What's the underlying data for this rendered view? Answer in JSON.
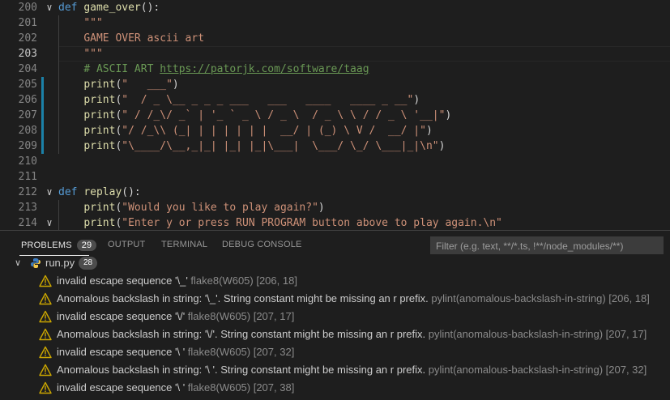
{
  "editor": {
    "lines": [
      {
        "num": "200",
        "fold": "∨",
        "tokens": [
          {
            "t": "def",
            "c": "kw"
          },
          {
            "t": " "
          },
          {
            "t": "game_over",
            "c": "fn"
          },
          {
            "t": "():"
          }
        ]
      },
      {
        "num": "201",
        "tokens": [
          {
            "t": "    "
          },
          {
            "t": "\"\"\"",
            "c": "str"
          }
        ]
      },
      {
        "num": "202",
        "tokens": [
          {
            "t": "    "
          },
          {
            "t": "GAME OVER ascii art",
            "c": "str"
          }
        ]
      },
      {
        "num": "203",
        "active": true,
        "current": true,
        "tokens": [
          {
            "t": "    "
          },
          {
            "t": "\"\"\"",
            "c": "str"
          }
        ]
      },
      {
        "num": "204",
        "tokens": [
          {
            "t": "    "
          },
          {
            "t": "# ASCII ART ",
            "c": "cmt"
          },
          {
            "t": "https://patorjk.com/software/taag",
            "c": "url"
          }
        ]
      },
      {
        "num": "205",
        "mod": true,
        "tokens": [
          {
            "t": "    "
          },
          {
            "t": "print",
            "c": "fn"
          },
          {
            "t": "("
          },
          {
            "t": "\"   ___\"",
            "c": "str"
          },
          {
            "t": ")"
          }
        ]
      },
      {
        "num": "206",
        "mod": true,
        "tokens": [
          {
            "t": "    "
          },
          {
            "t": "print",
            "c": "fn"
          },
          {
            "t": "("
          },
          {
            "t": "\"  / _ \\__ _ _ _ ___   ___   ____   ____ _ __\"",
            "c": "str"
          },
          {
            "t": ")"
          }
        ]
      },
      {
        "num": "207",
        "mod": true,
        "tokens": [
          {
            "t": "    "
          },
          {
            "t": "print",
            "c": "fn"
          },
          {
            "t": "("
          },
          {
            "t": "\" / /_\\/ _` | '_ ` _ \\ / _ \\  / _ \\ \\ / / _ \\ '__|\"",
            "c": "str"
          },
          {
            "t": ")"
          }
        ]
      },
      {
        "num": "208",
        "mod": true,
        "tokens": [
          {
            "t": "    "
          },
          {
            "t": "print",
            "c": "fn"
          },
          {
            "t": "("
          },
          {
            "t": "\"/ /_\\\\ (_| | | | | | |  __/ | (_) \\ V /  __/ |\"",
            "c": "str"
          },
          {
            "t": ")"
          }
        ]
      },
      {
        "num": "209",
        "mod": true,
        "tokens": [
          {
            "t": "    "
          },
          {
            "t": "print",
            "c": "fn"
          },
          {
            "t": "("
          },
          {
            "t": "\"\\____/\\__,_|_| |_| |_|\\___|  \\___/ \\_/ \\___|_|\\n\"",
            "c": "str"
          },
          {
            "t": ")"
          }
        ]
      },
      {
        "num": "210",
        "tokens": []
      },
      {
        "num": "211",
        "tokens": []
      },
      {
        "num": "212",
        "fold": "∨",
        "tokens": [
          {
            "t": "def",
            "c": "kw"
          },
          {
            "t": " "
          },
          {
            "t": "replay",
            "c": "fn"
          },
          {
            "t": "():"
          }
        ]
      },
      {
        "num": "213",
        "tokens": [
          {
            "t": "    "
          },
          {
            "t": "print",
            "c": "fn"
          },
          {
            "t": "("
          },
          {
            "t": "\"Would you like to play again?\"",
            "c": "str"
          },
          {
            "t": ")"
          }
        ]
      },
      {
        "num": "214",
        "fold": "∨",
        "tokens": [
          {
            "t": "    "
          },
          {
            "t": "print",
            "c": "fn"
          },
          {
            "t": "("
          },
          {
            "t": "\"Enter y or press RUN PROGRAM button above to play again.\\n\"",
            "c": "str"
          }
        ]
      }
    ]
  },
  "panel": {
    "tabs": [
      {
        "label": "PROBLEMS",
        "badge": "29",
        "active": true
      },
      {
        "label": "OUTPUT"
      },
      {
        "label": "TERMINAL"
      },
      {
        "label": "DEBUG CONSOLE"
      }
    ],
    "filter_placeholder": "Filter (e.g. text, **/*.ts, !**/node_modules/**)",
    "file": {
      "name": "run.py",
      "count": "28"
    },
    "problems": [
      {
        "message": "invalid escape sequence '\\_'",
        "source": "flake8(W605)",
        "location": "[206, 18]"
      },
      {
        "message": "Anomalous backslash in string: '\\_'. String constant might be missing an r prefix.",
        "source": "pylint(anomalous-backslash-in-string)",
        "location": "[206, 18]"
      },
      {
        "message": "invalid escape sequence '\\/'",
        "source": "flake8(W605)",
        "location": "[207, 17]"
      },
      {
        "message": "Anomalous backslash in string: '\\/'. String constant might be missing an r prefix.",
        "source": "pylint(anomalous-backslash-in-string)",
        "location": "[207, 17]"
      },
      {
        "message": "invalid escape sequence '\\ '",
        "source": "flake8(W605)",
        "location": "[207, 32]"
      },
      {
        "message": "Anomalous backslash in string: '\\ '. String constant might be missing an r prefix.",
        "source": "pylint(anomalous-backslash-in-string)",
        "location": "[207, 32]"
      },
      {
        "message": "invalid escape sequence '\\ '",
        "source": "flake8(W605)",
        "location": "[207, 38]"
      }
    ]
  },
  "colors": {
    "warning": "#cca700",
    "accent": "#1b81a8"
  },
  "icons": {
    "warning": "warning-icon",
    "python": "python-file-icon",
    "chevron": "chevron-down-icon"
  }
}
